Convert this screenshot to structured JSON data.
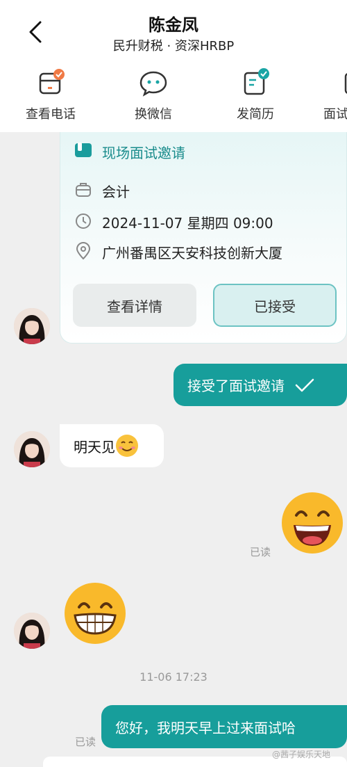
{
  "header": {
    "title": "陈金凤",
    "subtitle": "民升财税 · 资深HRBP"
  },
  "actions": [
    {
      "label": "查看电话",
      "icon": "phone-card-icon"
    },
    {
      "label": "换微信",
      "icon": "wechat-icon"
    },
    {
      "label": "发简历",
      "icon": "resume-icon"
    },
    {
      "label": "面试",
      "icon": "interview-icon"
    }
  ],
  "interview_card": {
    "title": "现场面试邀请",
    "position": "会计",
    "datetime": "2024-11-07 星期四 09:00",
    "address": "广州番禺区天安科技创新大厦",
    "detail_button": "查看详情",
    "accepted_button": "已接受"
  },
  "messages": {
    "accepted_notice": "接受了面试邀请",
    "see_you_tomorrow": "明天见",
    "read_1": "已读",
    "timestamp": "11-06 17:23",
    "morning_msg": "您好，我明天早上过来面试哈",
    "read_2": "已读"
  },
  "watermark": "@茜子娱乐天地",
  "colors": {
    "accent": "#179e9b",
    "card_title": "#1a8c8c",
    "badge": "#f07a45",
    "badge_teal": "#1aa5a5"
  }
}
